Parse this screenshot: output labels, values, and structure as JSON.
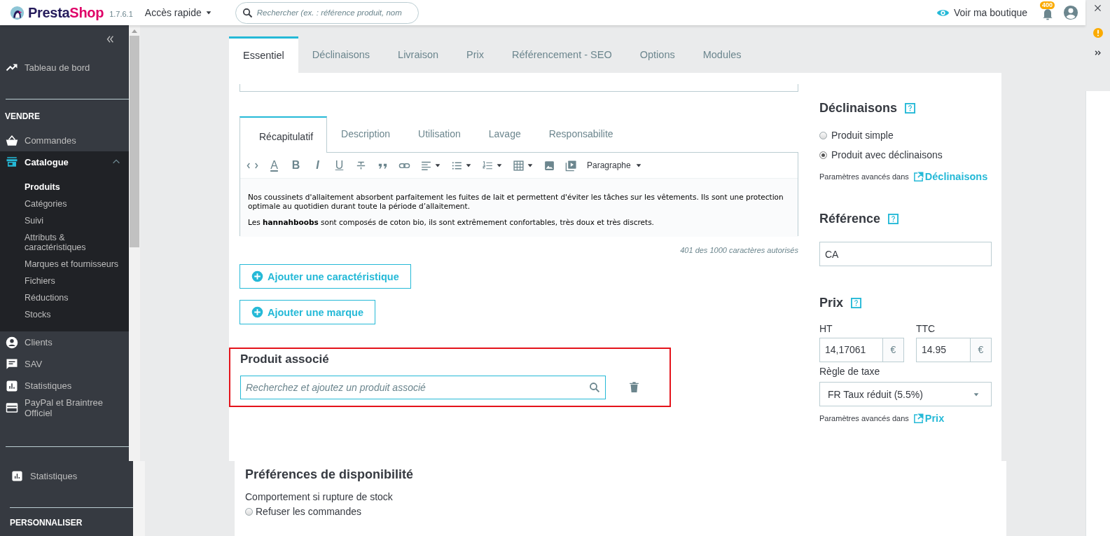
{
  "header": {
    "logo": [
      "Presta",
      "Shop"
    ],
    "version": "1.7.6.1",
    "quick_access": "Accès rapide",
    "search": {
      "placeholder": "Rechercher (ex. : référence produit, nom"
    },
    "view_shop": "Voir ma boutique",
    "notifications_badge": "400"
  },
  "sidebar": {
    "items": [
      {
        "kind": "link",
        "label": "Tableau de bord",
        "selected": false
      },
      {
        "kind": "section",
        "label": "VENDRE"
      },
      {
        "kind": "link",
        "label": "Commandes",
        "selected": false
      },
      {
        "kind": "group",
        "label": "Catalogue",
        "selected": true,
        "expanded": true,
        "children": [
          {
            "label": "Produits",
            "selected": true
          },
          {
            "label": "Catégories",
            "selected": false
          },
          {
            "label": "Suivi",
            "selected": false
          },
          {
            "label": "Attributs & caractéristiques",
            "selected": false
          },
          {
            "label": "Marques et fournisseurs",
            "selected": false
          },
          {
            "label": "Fichiers",
            "selected": false
          },
          {
            "label": "Réductions",
            "selected": false
          },
          {
            "label": "Stocks",
            "selected": false
          }
        ]
      },
      {
        "kind": "link",
        "label": "Clients",
        "selected": false
      },
      {
        "kind": "link",
        "label": "SAV",
        "selected": false
      },
      {
        "kind": "link",
        "label": "Statistiques",
        "selected": false
      },
      {
        "kind": "link",
        "label": "PayPal et Braintree Officiel",
        "selected": false
      }
    ]
  },
  "product_tabs": [
    {
      "label": "Essentiel",
      "selected": true
    },
    {
      "label": "Déclinaisons",
      "selected": false
    },
    {
      "label": "Livraison",
      "selected": false
    },
    {
      "label": "Prix",
      "selected": false
    },
    {
      "label": "Référencement - SEO",
      "selected": false
    },
    {
      "label": "Options",
      "selected": false
    },
    {
      "label": "Modules",
      "selected": false
    }
  ],
  "description_tabs": [
    {
      "label": "Récapitulatif",
      "selected": true
    },
    {
      "label": "Description",
      "selected": false
    },
    {
      "label": "Utilisation",
      "selected": false
    },
    {
      "label": "Lavage",
      "selected": false
    },
    {
      "label": "Responsabilite",
      "selected": false
    }
  ],
  "editor": {
    "toolbar": [
      {
        "kind": "code"
      },
      {
        "kind": "color",
        "glyph": "A"
      },
      {
        "kind": "bold",
        "glyph": "B"
      },
      {
        "kind": "italic",
        "glyph": "I"
      },
      {
        "kind": "underline",
        "glyph": "U"
      },
      {
        "kind": "strike"
      },
      {
        "kind": "quote"
      },
      {
        "kind": "link"
      },
      {
        "kind": "align",
        "dropdown": true
      },
      {
        "kind": "bullets",
        "dropdown": true
      },
      {
        "kind": "numbers",
        "dropdown": true
      },
      {
        "kind": "table",
        "dropdown": true
      },
      {
        "kind": "image"
      },
      {
        "kind": "media"
      },
      {
        "kind": "format",
        "label": "Paragraphe",
        "dropdown": true
      }
    ],
    "paragraphs": [
      "Nos coussinets d'allaitement absorbent parfaitement les fuites de lait et permettent d'éviter les tâches sur les vêtements. Ils sont une protection optimale au quotidien durant toute la période d’allaitement.",
      "Les **hannahboobs** sont composés de coton bio, ils sont extrêmement confortables, très doux et très discrets."
    ],
    "char_count": "401 des 1000 caractères autorisés"
  },
  "buttons": [
    "Ajouter une caractéristique",
    "Ajouter une marque"
  ],
  "related_product": {
    "title": "Produit associé",
    "highlighted": true,
    "search": {
      "placeholder": "Recherchez et ajoutez un produit associé"
    }
  },
  "declinaisons": {
    "title": "Déclinaisons",
    "options": [
      {
        "label": "Produit simple",
        "selected": false
      },
      {
        "label": "Produit avec déclinaisons",
        "selected": true
      }
    ],
    "advanced_text": "Paramètres avancés dans",
    "advanced_link": "Déclinaisons"
  },
  "reference": {
    "title": "Référence",
    "value": "CA"
  },
  "price": {
    "title": "Prix",
    "ht_label": "HT",
    "ht_value": "14,17061",
    "ht_currency": "€",
    "ttc_label": "TTC",
    "ttc_value": "14.95",
    "ttc_currency": "€",
    "tax_label": "Règle de taxe",
    "tax_value": "FR Taux réduit (5.5%)",
    "advanced_text": "Paramètres avancés dans",
    "advanced_link": "Prix"
  },
  "bottom_sidebar": {
    "items": [
      {
        "kind": "link",
        "label": "Statistiques",
        "selected": false
      },
      {
        "kind": "section",
        "label": "PERSONNALISER"
      }
    ]
  },
  "availability": {
    "title": "Préférences de disponibilité",
    "label": "Comportement si rupture de stock",
    "options": [
      {
        "label": "Refuser les commandes",
        "selected": false
      }
    ]
  }
}
